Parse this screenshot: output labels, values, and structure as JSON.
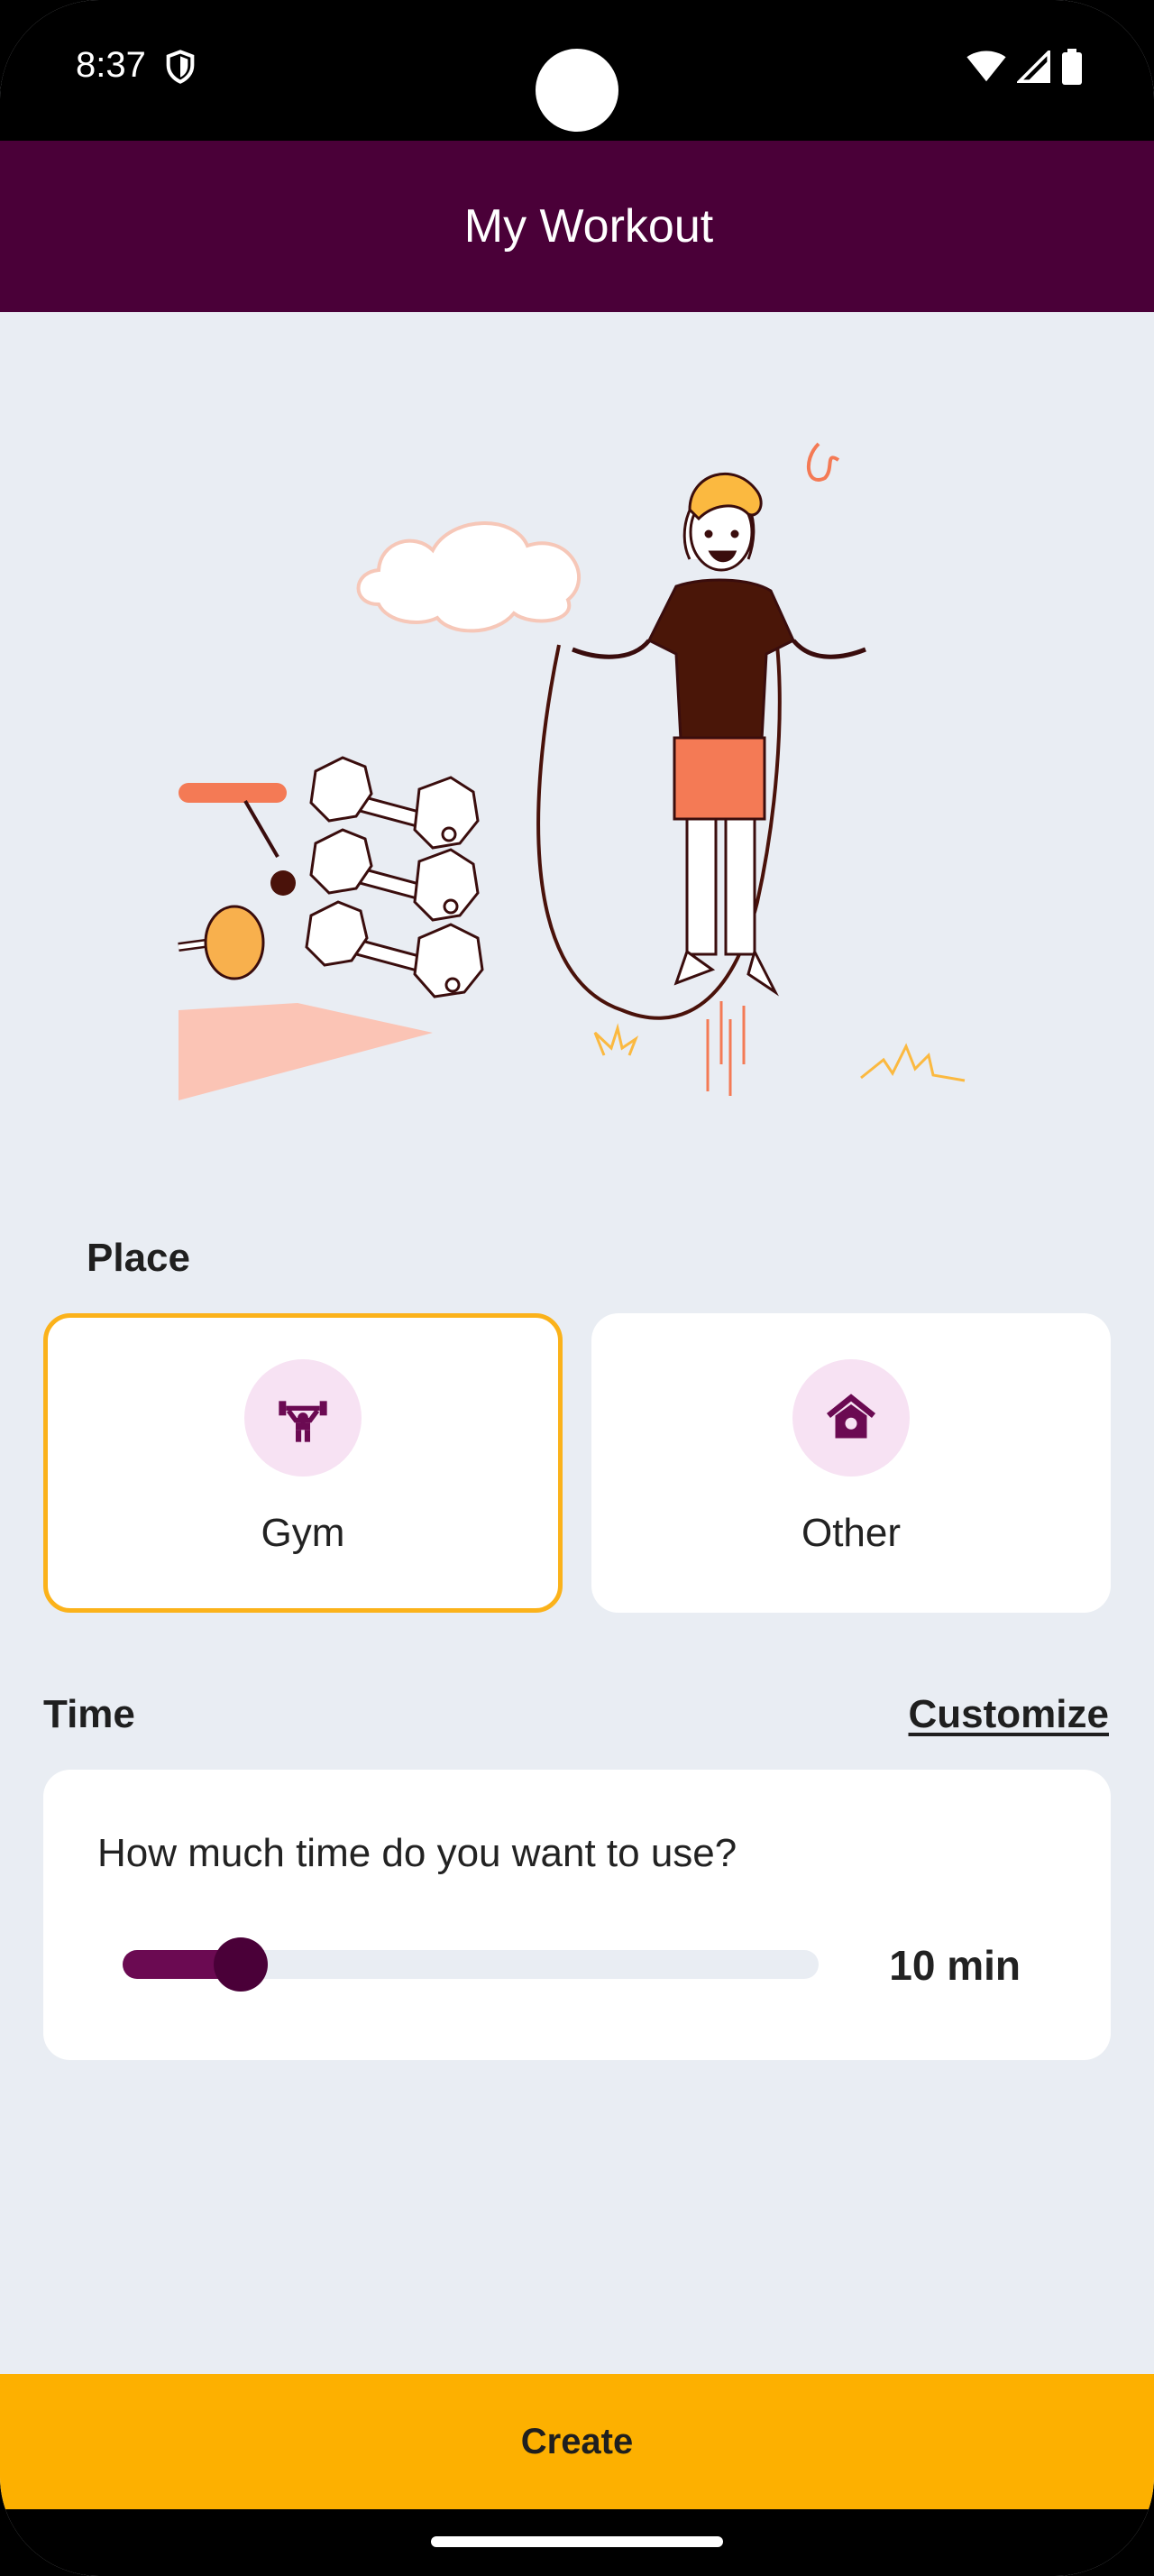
{
  "status_bar": {
    "time": "8:37"
  },
  "app_bar": {
    "title": "My Workout"
  },
  "place": {
    "label": "Place",
    "options": [
      {
        "label": "Gym",
        "icon": "weightlifter-icon",
        "selected": true
      },
      {
        "label": "Other",
        "icon": "home-icon",
        "selected": false
      }
    ]
  },
  "time": {
    "label": "Time",
    "customize_label": "Customize",
    "question": "How much time do you want to use?",
    "slider_fraction": 0.17,
    "value_text": "10 min"
  },
  "create": {
    "label": "Create"
  },
  "colors": {
    "app_bar": "#4a0038",
    "accent": "#fdb000",
    "background": "#e9edf3",
    "slider": "#6b0a52",
    "icon_bg": "#f7e2f3"
  }
}
